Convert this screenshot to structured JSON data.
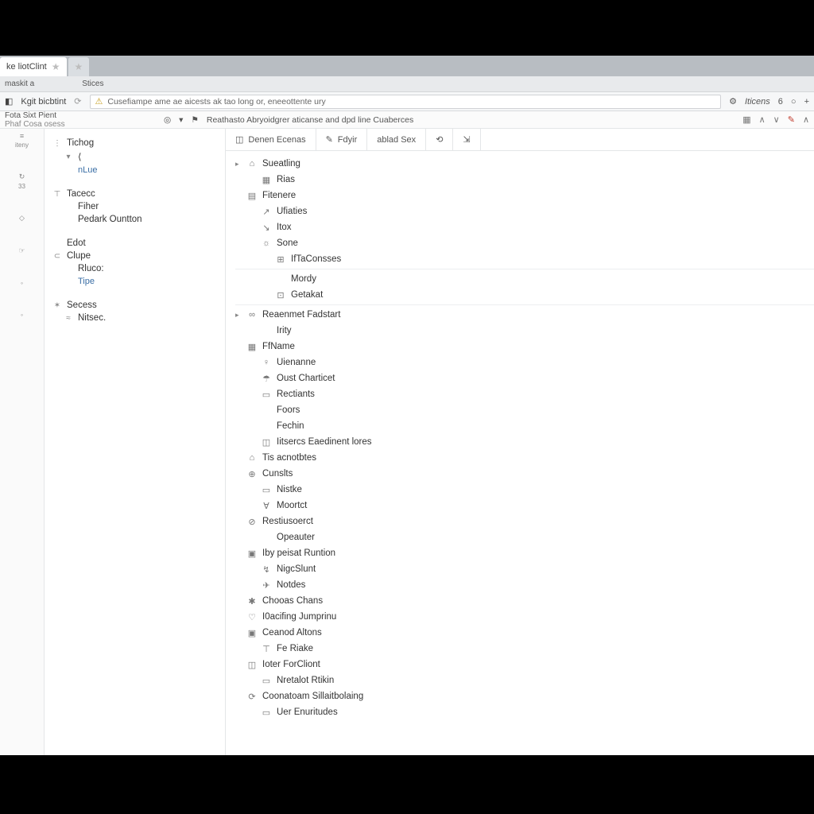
{
  "tabs": {
    "active": "ke liotClint",
    "inactive_icon": "★"
  },
  "subbar": {
    "left": "maskit a",
    "right": "Stices"
  },
  "toolbar": {
    "back_icon": "◧",
    "title": "Kgit bicbtint",
    "refresh_icon": "⟳",
    "warn_icon": "⚠",
    "address": "Cusefiampe ame ae aicests ak tao long or, eneeottente ury",
    "ext_icon": "⚙",
    "ext_label": "Iticens",
    "tab_count": "6",
    "search_icon": "○",
    "add_icon": "+"
  },
  "infobar": {
    "line1": "Fota Sixt Pient",
    "line2": "Phaf Cosa osess",
    "eye_icon": "◎",
    "dd_icon": "▾",
    "flag_icon": "⚑",
    "message": "Reathasto Abryoidgrer aticanse and dpd line Cuaberces",
    "r_icons": [
      "▦",
      "∧",
      "∨",
      "✎",
      "∧"
    ]
  },
  "rail": [
    {
      "icon": "≡",
      "label": "iteny"
    },
    {
      "icon": "↻",
      "label": "33"
    },
    {
      "icon": "◇",
      "label": ""
    },
    {
      "icon": "☞",
      "label": ""
    },
    {
      "icon": "◦",
      "label": ""
    },
    {
      "icon": "◦",
      "label": ""
    }
  ],
  "sidebar": {
    "g1": [
      {
        "ico": "⋮",
        "label": "Tichog"
      },
      {
        "ico": "▾",
        "label": "⟨",
        "cls": "child"
      },
      {
        "ico": "",
        "label": "nLue",
        "cls": "sub"
      }
    ],
    "g2": [
      {
        "ico": "⊤",
        "label": "Tacecc"
      },
      {
        "ico": "",
        "label": "Fiher",
        "cls": "child"
      },
      {
        "ico": "",
        "label": "Pedark Ountton",
        "cls": "child"
      }
    ],
    "g3": [
      {
        "ico": "",
        "label": "Edot"
      },
      {
        "ico": "⊂",
        "label": "Clupe"
      },
      {
        "ico": "",
        "label": "Rluco:",
        "cls": "child"
      },
      {
        "ico": "",
        "label": "Tipe",
        "cls": "sub"
      }
    ],
    "g4": [
      {
        "ico": "✶",
        "label": "Secess"
      },
      {
        "ico": "≈",
        "label": "Nitsec.",
        "cls": "child"
      }
    ]
  },
  "filters": [
    {
      "ico": "◫",
      "label": "Denen Ecenas",
      "active": true
    },
    {
      "ico": "✎",
      "label": "Fdyir"
    },
    {
      "ico": "",
      "label": "ablad Sex"
    },
    {
      "ico": "⟲",
      "label": ""
    },
    {
      "ico": "⇲",
      "label": ""
    }
  ],
  "tree": [
    {
      "lvl": 1,
      "tw": "▸",
      "ico": "⌂",
      "label": "Sueatling"
    },
    {
      "lvl": 2,
      "tw": "",
      "ico": "▦",
      "label": "Rias"
    },
    {
      "lvl": 1,
      "tw": "",
      "ico": "▤",
      "label": "Fitenere"
    },
    {
      "lvl": 2,
      "tw": "",
      "ico": "↗",
      "label": "Ufiaties"
    },
    {
      "lvl": 2,
      "tw": "",
      "ico": "↘",
      "label": "Itox"
    },
    {
      "lvl": 2,
      "tw": "",
      "ico": "☼",
      "label": "Sone"
    },
    {
      "lvl": 3,
      "tw": "",
      "ico": "⊞",
      "label": "IfTaConsses"
    },
    {
      "sep": true
    },
    {
      "lvl": 3,
      "tw": "",
      "ico": "",
      "label": "Mordy"
    },
    {
      "lvl": 3,
      "tw": "",
      "ico": "⊡",
      "label": "Getakat"
    },
    {
      "sep": true
    },
    {
      "lvl": 1,
      "tw": "▸",
      "ico": "∞",
      "label": "Reaenmet Fadstart"
    },
    {
      "lvl": 2,
      "tw": "",
      "ico": "",
      "label": "Irity"
    },
    {
      "lvl": 1,
      "tw": "",
      "ico": "▦",
      "label": "FfName"
    },
    {
      "lvl": 2,
      "tw": "",
      "ico": "♀",
      "label": "Uienanne"
    },
    {
      "lvl": 2,
      "tw": "",
      "ico": "☂",
      "label": "Oust Charticet"
    },
    {
      "lvl": 2,
      "tw": "",
      "ico": "▭",
      "label": "Rectiants"
    },
    {
      "lvl": 2,
      "tw": "",
      "ico": "",
      "label": "Foors"
    },
    {
      "lvl": 2,
      "tw": "",
      "ico": "",
      "label": "Fechin"
    },
    {
      "lvl": 2,
      "tw": "",
      "ico": "◫",
      "label": "Iitsercs Eaedinent lores"
    },
    {
      "lvl": 1,
      "tw": "",
      "ico": "⌂",
      "label": "Tis acnotbtes"
    },
    {
      "lvl": 1,
      "tw": "",
      "ico": "⊕",
      "label": "Cunslts"
    },
    {
      "lvl": 2,
      "tw": "",
      "ico": "▭",
      "label": "Nistke"
    },
    {
      "lvl": 2,
      "tw": "",
      "ico": "∀",
      "label": "Moortct"
    },
    {
      "lvl": 1,
      "tw": "",
      "ico": "⊘",
      "label": "Restiusoerct"
    },
    {
      "lvl": 2,
      "tw": "",
      "ico": "",
      "label": "Opeauter"
    },
    {
      "lvl": 1,
      "tw": "",
      "ico": "▣",
      "label": "Iby peisat Runtion"
    },
    {
      "lvl": 2,
      "tw": "",
      "ico": "↯",
      "label": "NigcSlunt"
    },
    {
      "lvl": 2,
      "tw": "",
      "ico": "✈",
      "label": "Notdes"
    },
    {
      "lvl": 1,
      "tw": "",
      "ico": "✱",
      "label": "Chooas Chans"
    },
    {
      "lvl": 1,
      "tw": "",
      "ico": "♡",
      "label": "I0acifing Jumprinu"
    },
    {
      "lvl": 1,
      "tw": "",
      "ico": "▣",
      "label": "Ceanod Altons"
    },
    {
      "lvl": 2,
      "tw": "",
      "ico": "⊤",
      "label": "Fe Riake"
    },
    {
      "lvl": 1,
      "tw": "",
      "ico": "◫",
      "label": "Ioter ForCliont"
    },
    {
      "lvl": 2,
      "tw": "",
      "ico": "▭",
      "label": "Nretalot Rtikin"
    },
    {
      "lvl": 1,
      "tw": "",
      "ico": "⟳",
      "label": "Coonatoam Sillaitbolaing"
    },
    {
      "lvl": 2,
      "tw": "",
      "ico": "▭",
      "label": "Uer Enuritudes"
    }
  ]
}
